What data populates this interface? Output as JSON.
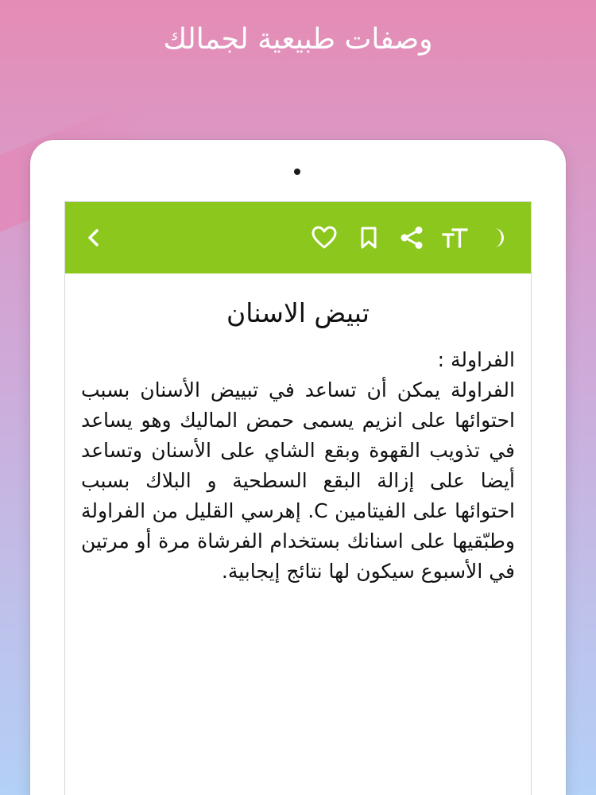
{
  "promo": {
    "title": "وصفات طبيعية لجمالك"
  },
  "toolbar": {
    "color": "#8cc71d",
    "icons": [
      "back-chevron-icon",
      "heart-icon",
      "bookmark-icon",
      "share-icon",
      "font-size-icon",
      "night-mode-moon-icon"
    ]
  },
  "article": {
    "title": "تبيض الاسنان",
    "heading": "الفراولة :",
    "body": "الفراولة يمكن أن تساعد في تبييض الأسنان بسبب احتوائها على انزيم يسمى حمض الماليك وهو يساعد في تذويب القهوة وبقع الشاي على الأسنان وتساعد أيضا على إزالة البقع السطحية و البلاك بسبب احتوائها على الفيتامين C. إهرسي القليل من الفراولة وطبّقيها على اسنانك بستخدام الفرشاة مرة أو مرتين في الأسبوع سيكون لها نتائج إيجابية."
  }
}
